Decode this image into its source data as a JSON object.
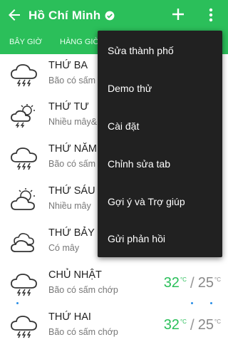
{
  "appbar": {
    "title": "Hồ Chí Minh",
    "back_icon": "arrow-left-icon",
    "verified_icon": "check-circle-icon",
    "add_icon": "plus-icon",
    "more_icon": "more-vertical-icon",
    "color": "#2bbf5a"
  },
  "tabs": [
    {
      "label": "BÂY GIỜ"
    },
    {
      "label": "HÀNG GIỜ"
    }
  ],
  "forecast": [
    {
      "day": "THỨ BA",
      "desc": "Bão có sấm chớp",
      "icon": "thunderstorm-icon"
    },
    {
      "day": "THỨ TƯ",
      "desc": "Nhiều mây&",
      "icon": "partly-cloudy-storm-icon"
    },
    {
      "day": "THỨ NĂM",
      "desc": "Bão có sấm",
      "icon": "thunderstorm-icon"
    },
    {
      "day": "THỨ SÁU",
      "desc": "Nhiều mây",
      "icon": "partly-cloudy-icon"
    },
    {
      "day": "THỨ BẢY",
      "desc": "Có mây",
      "icon": "cloudy-icon"
    },
    {
      "day": "CHỦ NHẬT",
      "desc": "Bão có sấm chớp",
      "icon": "thunderstorm-icon",
      "hi": "32",
      "lo": "25",
      "unit": "°C"
    },
    {
      "day": "THỨ HAI",
      "desc": "Bão có sấm chớp",
      "icon": "thunderstorm-icon",
      "hi": "32",
      "lo": "25",
      "unit": "°C"
    }
  ],
  "menu": {
    "items": [
      {
        "label": "Sửa thành phố"
      },
      {
        "label": "Demo thử"
      },
      {
        "label": "Cài đặt"
      },
      {
        "label": "Chỉnh sửa tab"
      },
      {
        "label": "Gợi ý và Trợ giúp"
      },
      {
        "label": "Gửi phản hồi"
      }
    ]
  },
  "colors": {
    "accent": "#2bbf5a",
    "menu_bg": "#212121",
    "dot": "#2b8ee6"
  }
}
